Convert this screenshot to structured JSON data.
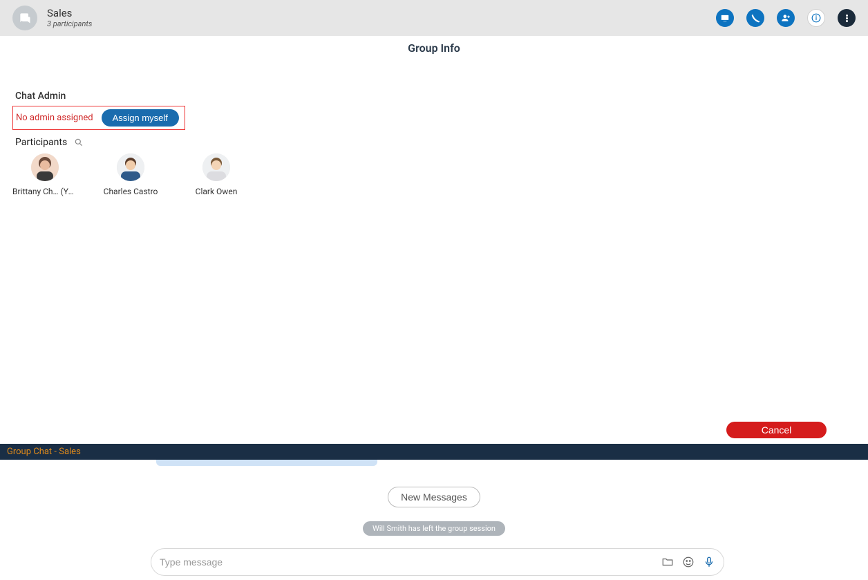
{
  "header": {
    "title": "Sales",
    "subtitle": "3 participants"
  },
  "panel": {
    "title": "Group Info",
    "admin_heading": "Chat Admin",
    "no_admin_text": "No admin assigned",
    "assign_label": "Assign myself",
    "participants_heading": "Participants",
    "participants": [
      {
        "name": "Brittany Ch… (You)"
      },
      {
        "name": "Charles Castro"
      },
      {
        "name": "Clark Owen"
      }
    ],
    "cancel_label": "Cancel"
  },
  "chat": {
    "strip_label": "Group Chat - Sales",
    "new_messages_label": "New Messages",
    "system_message": "Will Smith has left the group session",
    "composer_placeholder": "Type message"
  },
  "colors": {
    "accent_blue": "#0d73c0",
    "danger": "#d51c1c",
    "dark": "#1a2e45"
  }
}
